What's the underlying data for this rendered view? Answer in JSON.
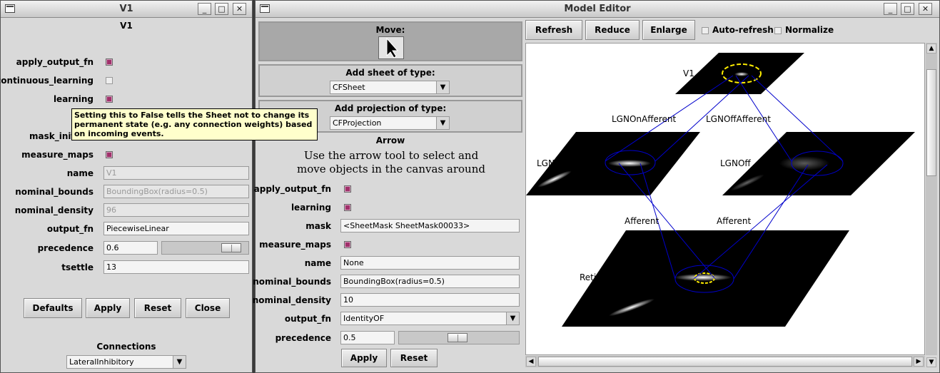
{
  "v1_window": {
    "title": "V1",
    "heading": "V1",
    "params": [
      {
        "label": "apply_output_fn",
        "type": "check",
        "checked": true
      },
      {
        "label": "continuous_learning",
        "type": "check",
        "checked": false
      },
      {
        "label": "learning",
        "type": "check",
        "checked": true
      },
      {
        "label": "mask_init",
        "type": "hidden"
      },
      {
        "label": "measure_maps",
        "type": "check",
        "checked": true
      },
      {
        "label": "name",
        "type": "text",
        "value": "V1",
        "disabled": true
      },
      {
        "label": "nominal_bounds",
        "type": "text",
        "value": "BoundingBox(radius=0.5)",
        "disabled": true
      },
      {
        "label": "nominal_density",
        "type": "text",
        "value": "96",
        "disabled": true
      },
      {
        "label": "output_fn",
        "type": "text",
        "value": "PiecewiseLinear"
      },
      {
        "label": "precedence",
        "type": "slider",
        "value": "0.6",
        "level": 0.6
      },
      {
        "label": "tsettle",
        "type": "text",
        "value": "13"
      }
    ],
    "tooltip": "Setting this to False tells the Sheet not to change its permanent state (e.g. any connection weights) based on incoming events.",
    "buttons": {
      "defaults": "Defaults",
      "apply": "Apply",
      "reset": "Reset",
      "close": "Close"
    },
    "connections_label": "Connections",
    "connections_value": "LateralInhibitory"
  },
  "model_editor": {
    "title": "Model Editor",
    "move_label": "Move:",
    "add_sheet_label": "Add sheet of type:",
    "sheet_type": "CFSheet",
    "add_projection_label": "Add projection of type:",
    "projection_type": "CFProjection",
    "tool_name": "Arrow",
    "tool_description": "Use the arrow tool to select and move objects in the canvas around",
    "params": [
      {
        "label": "apply_output_fn",
        "type": "check",
        "checked": true
      },
      {
        "label": "learning",
        "type": "check",
        "checked": true
      },
      {
        "label": "mask",
        "type": "text",
        "value": "<SheetMask SheetMask00033>"
      },
      {
        "label": "measure_maps",
        "type": "check",
        "checked": true
      },
      {
        "label": "name",
        "type": "text",
        "value": "None"
      },
      {
        "label": "nominal_bounds",
        "type": "text",
        "value": "BoundingBox(radius=0.5)"
      },
      {
        "label": "nominal_density",
        "type": "text",
        "value": "10"
      },
      {
        "label": "output_fn",
        "type": "dropdown",
        "value": "IdentityOF"
      },
      {
        "label": "precedence",
        "type": "slider",
        "value": "0.5",
        "level": 0.5
      }
    ],
    "apply": "Apply",
    "reset": "Reset",
    "toolbar": {
      "refresh": "Refresh",
      "reduce": "Reduce",
      "enlarge": "Enlarge",
      "auto_refresh": "Auto-refresh",
      "normalize": "Normalize"
    },
    "canvas": {
      "sheets": {
        "v1": "V1",
        "lgnon": "LGNOn",
        "lgnoff": "LGNOff",
        "retina": "Retina"
      },
      "projections": {
        "lgnon_afferent": "LGNOnAfferent",
        "lgnoff_afferent": "LGNOffAfferent",
        "afferent_left": "Afferent",
        "afferent_right": "Afferent"
      }
    }
  }
}
